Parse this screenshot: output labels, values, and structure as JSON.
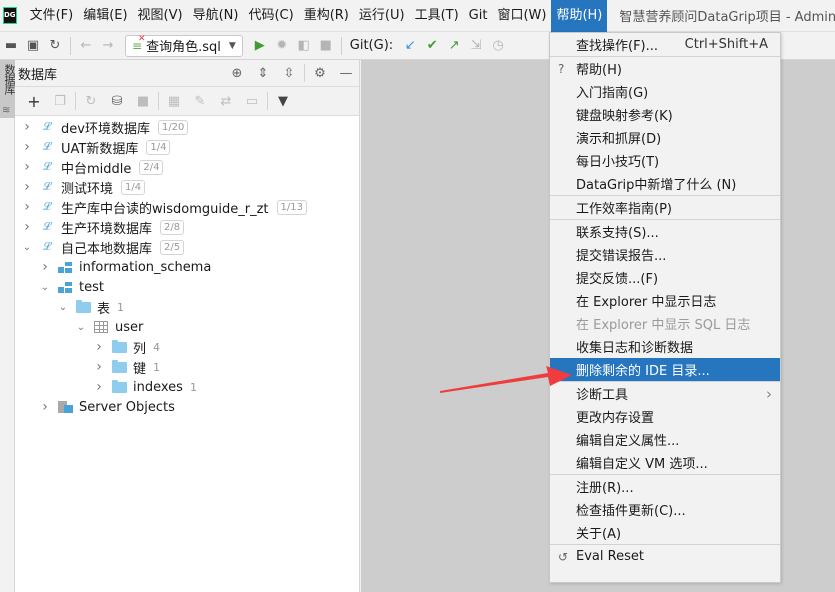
{
  "app": {
    "logo": "DG",
    "window_title": "智慧营养顾问DataGrip项目 - Admin"
  },
  "menubar": {
    "items": [
      "文件(F)",
      "编辑(E)",
      "视图(V)",
      "导航(N)",
      "代码(C)",
      "重构(R)",
      "运行(U)",
      "工具(T)",
      "Git",
      "窗口(W)",
      "帮助(H)"
    ],
    "active_index": 10
  },
  "toolbar": {
    "run_config": "查询角色.sql",
    "git_label": "Git(G):"
  },
  "side_strip": {
    "tab_label": "数据库"
  },
  "database_panel": {
    "title": "数据库",
    "tree": [
      {
        "label": "dev环境数据库",
        "badge": "1/20",
        "expanded": false,
        "level": 0,
        "kind": "datasource"
      },
      {
        "label": "UAT新数据库",
        "badge": "1/4",
        "expanded": false,
        "level": 0,
        "kind": "datasource"
      },
      {
        "label": "中台middle",
        "badge": "2/4",
        "expanded": false,
        "level": 0,
        "kind": "datasource"
      },
      {
        "label": "测试环境",
        "badge": "1/4",
        "expanded": false,
        "level": 0,
        "kind": "datasource"
      },
      {
        "label": "生产库中台读的wisdomguide_r_zt",
        "badge": "1/13",
        "expanded": false,
        "level": 0,
        "kind": "datasource"
      },
      {
        "label": "生产环境数据库",
        "badge": "2/8",
        "expanded": false,
        "level": 0,
        "kind": "datasource"
      },
      {
        "label": "自己本地数据库",
        "badge": "2/5",
        "expanded": true,
        "level": 0,
        "kind": "datasource"
      },
      {
        "label": "information_schema",
        "count": "",
        "expanded": false,
        "level": 1,
        "kind": "schema"
      },
      {
        "label": "test",
        "count": "",
        "expanded": true,
        "level": 1,
        "kind": "schema"
      },
      {
        "label": "表",
        "count": "1",
        "expanded": true,
        "level": 2,
        "kind": "folder"
      },
      {
        "label": "user",
        "count": "",
        "expanded": true,
        "level": 3,
        "kind": "table"
      },
      {
        "label": "列",
        "count": "4",
        "expanded": false,
        "level": 4,
        "kind": "folder"
      },
      {
        "label": "键",
        "count": "1",
        "expanded": false,
        "level": 4,
        "kind": "folder"
      },
      {
        "label": "indexes",
        "count": "1",
        "expanded": false,
        "level": 4,
        "kind": "folder"
      },
      {
        "label": "Server Objects",
        "count": "",
        "expanded": false,
        "level": 1,
        "kind": "server"
      }
    ]
  },
  "help_menu": {
    "groups": [
      [
        {
          "label": "查找操作(F)...",
          "shortcut": "Ctrl+Shift+A"
        }
      ],
      [
        {
          "label": "帮助(H)",
          "lead_icon": "?"
        },
        {
          "label": "入门指南(G)"
        },
        {
          "label": "键盘映射参考(K)"
        },
        {
          "label": "演示和抓屏(D)"
        },
        {
          "label": "每日小技巧(T)"
        },
        {
          "label": "DataGrip中新增了什么 (N)"
        }
      ],
      [
        {
          "label": "工作效率指南(P)"
        }
      ],
      [
        {
          "label": "联系支持(S)..."
        },
        {
          "label": "提交错误报告..."
        },
        {
          "label": "提交反馈...(F)"
        },
        {
          "label": "在 Explorer 中显示日志"
        },
        {
          "label": "在 Explorer 中显示 SQL 日志",
          "disabled": true
        },
        {
          "label": "收集日志和诊断数据"
        },
        {
          "label": "删除剩余的 IDE 目录...",
          "selected": true
        }
      ],
      [
        {
          "label": "诊断工具",
          "submenu": true
        },
        {
          "label": "更改内存设置"
        },
        {
          "label": "编辑自定义属性..."
        },
        {
          "label": "编辑自定义 VM 选项..."
        }
      ],
      [
        {
          "label": "注册(R)..."
        },
        {
          "label": "检查插件更新(C)..."
        },
        {
          "label": "关于(A)"
        }
      ],
      [
        {
          "label": "Eval Reset",
          "lead_icon": "↺"
        }
      ]
    ]
  },
  "annotation": {
    "arrow_color": "#f03c3c",
    "points_to": "删除剩余的 IDE 目录..."
  }
}
